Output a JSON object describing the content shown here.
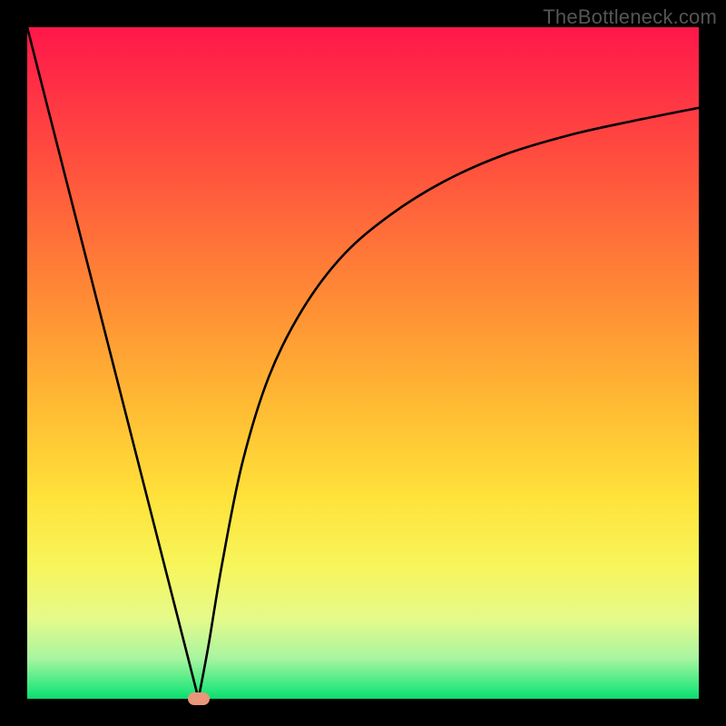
{
  "watermark": "TheBottleneck.com",
  "chart_data": {
    "type": "line",
    "title": "",
    "xlabel": "",
    "ylabel": "",
    "xlim": [
      0,
      100
    ],
    "ylim": [
      0,
      100
    ],
    "series": [
      {
        "name": "left-branch",
        "x": [
          0,
          5,
          10,
          15,
          20,
          24,
          25.5
        ],
        "y": [
          100,
          80,
          60,
          40,
          20,
          4,
          0
        ]
      },
      {
        "name": "right-branch",
        "x": [
          25.5,
          27,
          29,
          32,
          36,
          41,
          47,
          54,
          62,
          71,
          81,
          90,
          100
        ],
        "y": [
          0,
          8,
          20,
          35,
          48,
          58,
          66,
          72,
          77,
          81,
          84,
          86,
          88
        ]
      }
    ],
    "marker": {
      "x": 25.5,
      "y": 0,
      "color": "#e9967a"
    },
    "background_gradient": {
      "stops": [
        {
          "offset": 0.0,
          "color": "#ff174a"
        },
        {
          "offset": 0.2,
          "color": "#ff4f3e"
        },
        {
          "offset": 0.4,
          "color": "#ff8a35"
        },
        {
          "offset": 0.55,
          "color": "#ffb733"
        },
        {
          "offset": 0.7,
          "color": "#ffe23a"
        },
        {
          "offset": 0.8,
          "color": "#f7f55a"
        },
        {
          "offset": 0.88,
          "color": "#e6fa8a"
        },
        {
          "offset": 0.94,
          "color": "#a8f5a0"
        },
        {
          "offset": 0.985,
          "color": "#2fe87f"
        },
        {
          "offset": 1.0,
          "color": "#0bdc6c"
        }
      ]
    }
  }
}
